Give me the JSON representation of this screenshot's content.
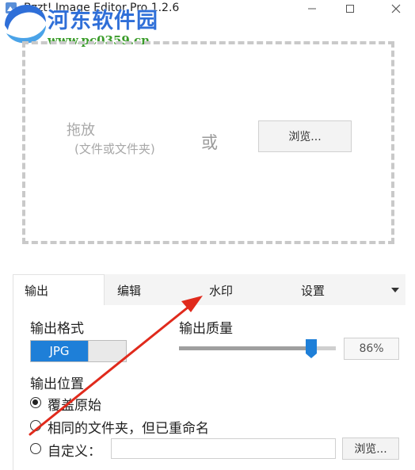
{
  "window": {
    "title": "Bzzt! Image Editor Pro 1.2.6",
    "controls": [
      "minimize",
      "maximize",
      "close"
    ]
  },
  "watermark": {
    "brand": "河东软件园",
    "url": "www.pc0359.cn"
  },
  "dropzone": {
    "drop_label": "拖放",
    "drop_hint": "(文件或文件夹)",
    "or_label": "或",
    "browse_label": "浏览..."
  },
  "tabs": [
    {
      "label": "输出",
      "active": true
    },
    {
      "label": "编辑",
      "active": false
    },
    {
      "label": "水印",
      "active": false
    },
    {
      "label": "设置",
      "active": false
    }
  ],
  "output": {
    "format_label": "输出格式",
    "format_value": "JPG",
    "format_toggle_on": true,
    "quality_label": "输出质量",
    "quality_percent": 86,
    "quality_text": "86%",
    "location_label": "输出位置",
    "location_options": [
      {
        "label": "覆盖原始",
        "selected": true
      },
      {
        "label": "相同的文件夹，但已重命名",
        "selected": false
      },
      {
        "label": "自定义：",
        "selected": false
      }
    ],
    "custom_path_value": "",
    "browse_label": "浏览..."
  },
  "colors": {
    "accent": "#1e7fd8",
    "annotation_arrow": "#e02a1c",
    "watermark_blue": "#2f6fd8",
    "watermark_green": "#3a9c2a"
  }
}
